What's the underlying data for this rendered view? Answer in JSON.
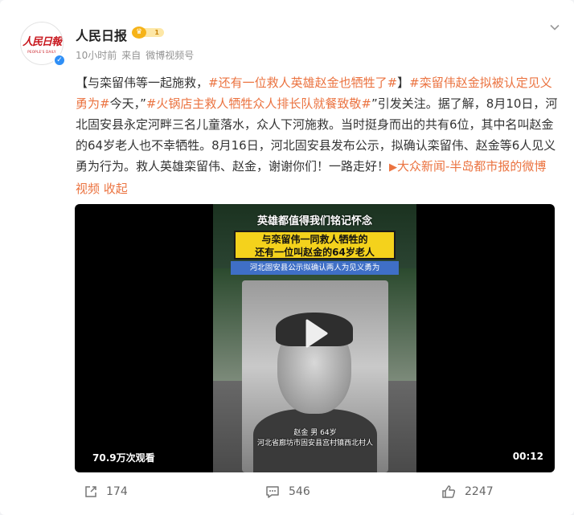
{
  "header": {
    "avatar_logo_cn": "人民日報",
    "avatar_logo_en": "PEOPLE'S DAILY",
    "author_name": "人民日报",
    "badge_level": "1",
    "time": "10小时前",
    "source_prefix": "来自",
    "source": "微博视频号"
  },
  "post": {
    "seg1": "【与栾留伟等一起施救，",
    "tag1": "#还有一位救人英雄赵金也牺牲了#",
    "seg2": "】",
    "tag2": "#栾留伟赵金拟被认定见义勇为#",
    "seg3": "今天，”",
    "tag3": "#火锅店主救人牺牲众人排长队就餐致敬#",
    "seg4": "”引发关注。据了解，8月10日，河北固安县永定河畔三名儿童落水，众人下河施救。当时挺身而出的共有6位，其中名叫赵金的64岁老人也不幸牺牲。8月16日，河北固安县发布公示，拟确认栾留伟、赵金等6人见义勇为行为。救人英雄栾留伟、赵金，谢谢你们！一路走好！",
    "link_text": "大众新闻-半岛都市报的微博视频",
    "collapse_text": "收起"
  },
  "video": {
    "banner1": "英雄都值得我们铭记怀念",
    "banner2_line1": "与栾留伟一同救人牺牲的",
    "banner2_line2": "还有一位叫赵金的64岁老人",
    "banner3": "河北固安县公示拟确认两人为见义勇为",
    "caption_line1": "赵金 男 64岁",
    "caption_line2": "河北省廊坊市固安县宫村镇西北村人",
    "view_count": "70.9万次观看",
    "duration": "00:12"
  },
  "actions": {
    "share_count": "174",
    "comment_count": "546",
    "like_count": "2247"
  },
  "icons": {
    "more": "chevron-down-icon",
    "verify": "verified-badge-icon",
    "play": "play-icon",
    "share": "share-icon",
    "comment": "comment-icon",
    "like": "thumbs-up-icon",
    "link": "video-link-icon"
  },
  "colors": {
    "accent": "#eb7340",
    "verify": "#2f8ff6",
    "banner_yellow": "#f4d21c",
    "banner_blue": "#3f6fc6"
  }
}
